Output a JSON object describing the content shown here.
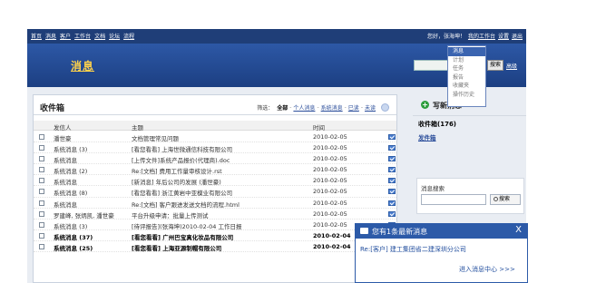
{
  "top_nav": [
    "首页",
    "消息",
    "客户",
    "工作台",
    "文档",
    "论坛",
    "流程"
  ],
  "top_right": {
    "greeting": "您好，张海坤！",
    "links": [
      "我的工作台",
      "设置",
      "退出"
    ]
  },
  "header": {
    "page_title": "消息",
    "search_button": "搜索",
    "advanced_link": "高级"
  },
  "dropdown_menu": {
    "items": [
      "消息",
      "计划",
      "任务",
      "报告",
      "收藏夹",
      "操作历史"
    ],
    "selected": "消息"
  },
  "inbox": {
    "title": "收件箱",
    "filter_label": "筛选：",
    "filters": [
      "全部",
      "个人消息",
      "系统消息",
      "已读",
      "未读"
    ],
    "active_filter": "全部",
    "columns": [
      "发信人",
      "主题",
      "时间"
    ],
    "rows": [
      {
        "sender": "潘世豪",
        "subject": "文档管理常见问题",
        "time": "2010-02-05",
        "bold": false
      },
      {
        "sender": "系统消息 (3)",
        "subject": "[看您看看] 上海世微通信科技有限公司",
        "time": "2010-02-05",
        "bold": false
      },
      {
        "sender": "系统消息",
        "subject": "[上传文件]系统产品报价(代理商).doc",
        "time": "2010-02-05",
        "bold": false
      },
      {
        "sender": "系统消息 (2)",
        "subject": "Re:[文档] 费用工作量审核设计.rst",
        "time": "2010-02-05",
        "bold": false
      },
      {
        "sender": "系统消息",
        "subject": "[新消息] 年后公司的发展 (潘世豪)",
        "time": "2010-02-05",
        "bold": false
      },
      {
        "sender": "系统消息 (8)",
        "subject": "[看您看看] 浙江黄岩中亚模业有限公司",
        "time": "2010-02-05",
        "bold": false
      },
      {
        "sender": "系统消息",
        "subject": "Re:[文档] 客户跟进发送文档的流程.html",
        "time": "2010-02-05",
        "bold": false
      },
      {
        "sender": "罗建峰, 张炳凯, 潘世豪",
        "subject": "平台升级申请：批量上传测试",
        "time": "2010-02-05",
        "bold": false
      },
      {
        "sender": "系统消息 (3)",
        "subject": "[待评报告](张海坤)2010-02-04 工作日报",
        "time": "2010-02-05",
        "bold": false
      },
      {
        "sender": "系统消息 (37)",
        "subject": "[看您看看] 广州巴宝真化妆品有限公司",
        "time": "2010-02-04",
        "bold": true
      },
      {
        "sender": "系统消息 (25)",
        "subject": "[看您看看] 上海亚源制帽有限公司",
        "time": "2010-02-04",
        "bold": true
      }
    ]
  },
  "sidebar": {
    "write_label": "写新消息",
    "inbox_count": "收件箱(176)",
    "archive_link": "发件箱",
    "search_title": "消息搜索",
    "search_button": "搜索"
  },
  "notification": {
    "title": "您有1条最新消息",
    "close": "X",
    "message": "Re:[客户] 建工集团省二建深圳分公司",
    "link": "进入消息中心 >>>"
  }
}
